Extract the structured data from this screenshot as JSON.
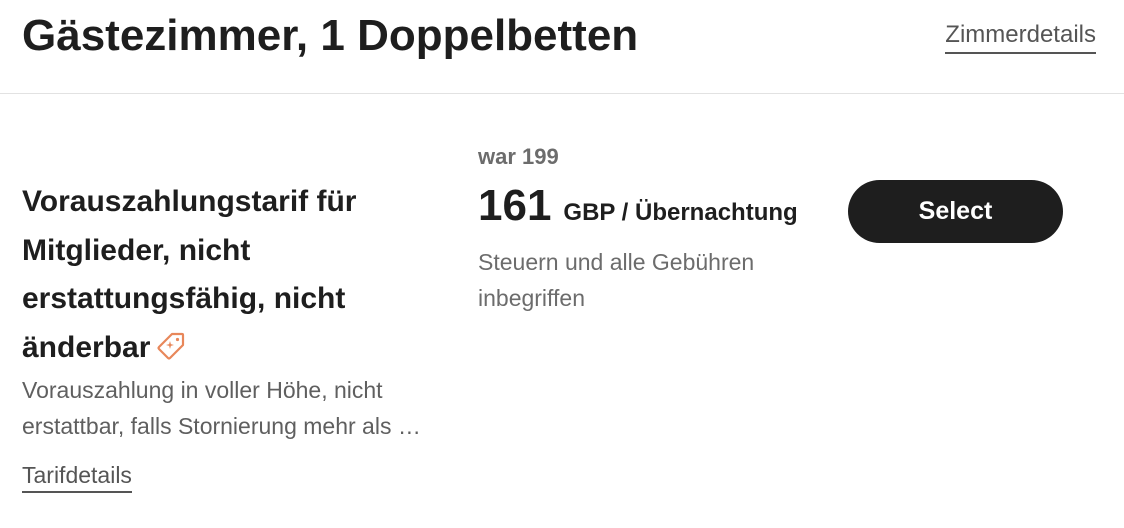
{
  "room": {
    "title": "Gästezimmer, 1 Doppelbetten",
    "details_link": "Zimmerdetails"
  },
  "rate": {
    "title": "Vorauszahlungstarif für Mitglieder, nicht erstattungsfähig, nicht änderbar",
    "badge_icon": "tag-sparkle-icon",
    "badge_color": "#e8875a",
    "description": "Vorauszahlung in voller Höhe, nicht erstattbar, falls Stornierung mehr als …",
    "details_link": "Tarifdetails"
  },
  "price": {
    "old_price": "war 199",
    "amount": "161",
    "unit": "GBP / Übernachtung",
    "note": "Steuern und alle Gebühren inbegriffen"
  },
  "actions": {
    "select_label": "Select",
    "button_color": "#1e1e1e"
  }
}
